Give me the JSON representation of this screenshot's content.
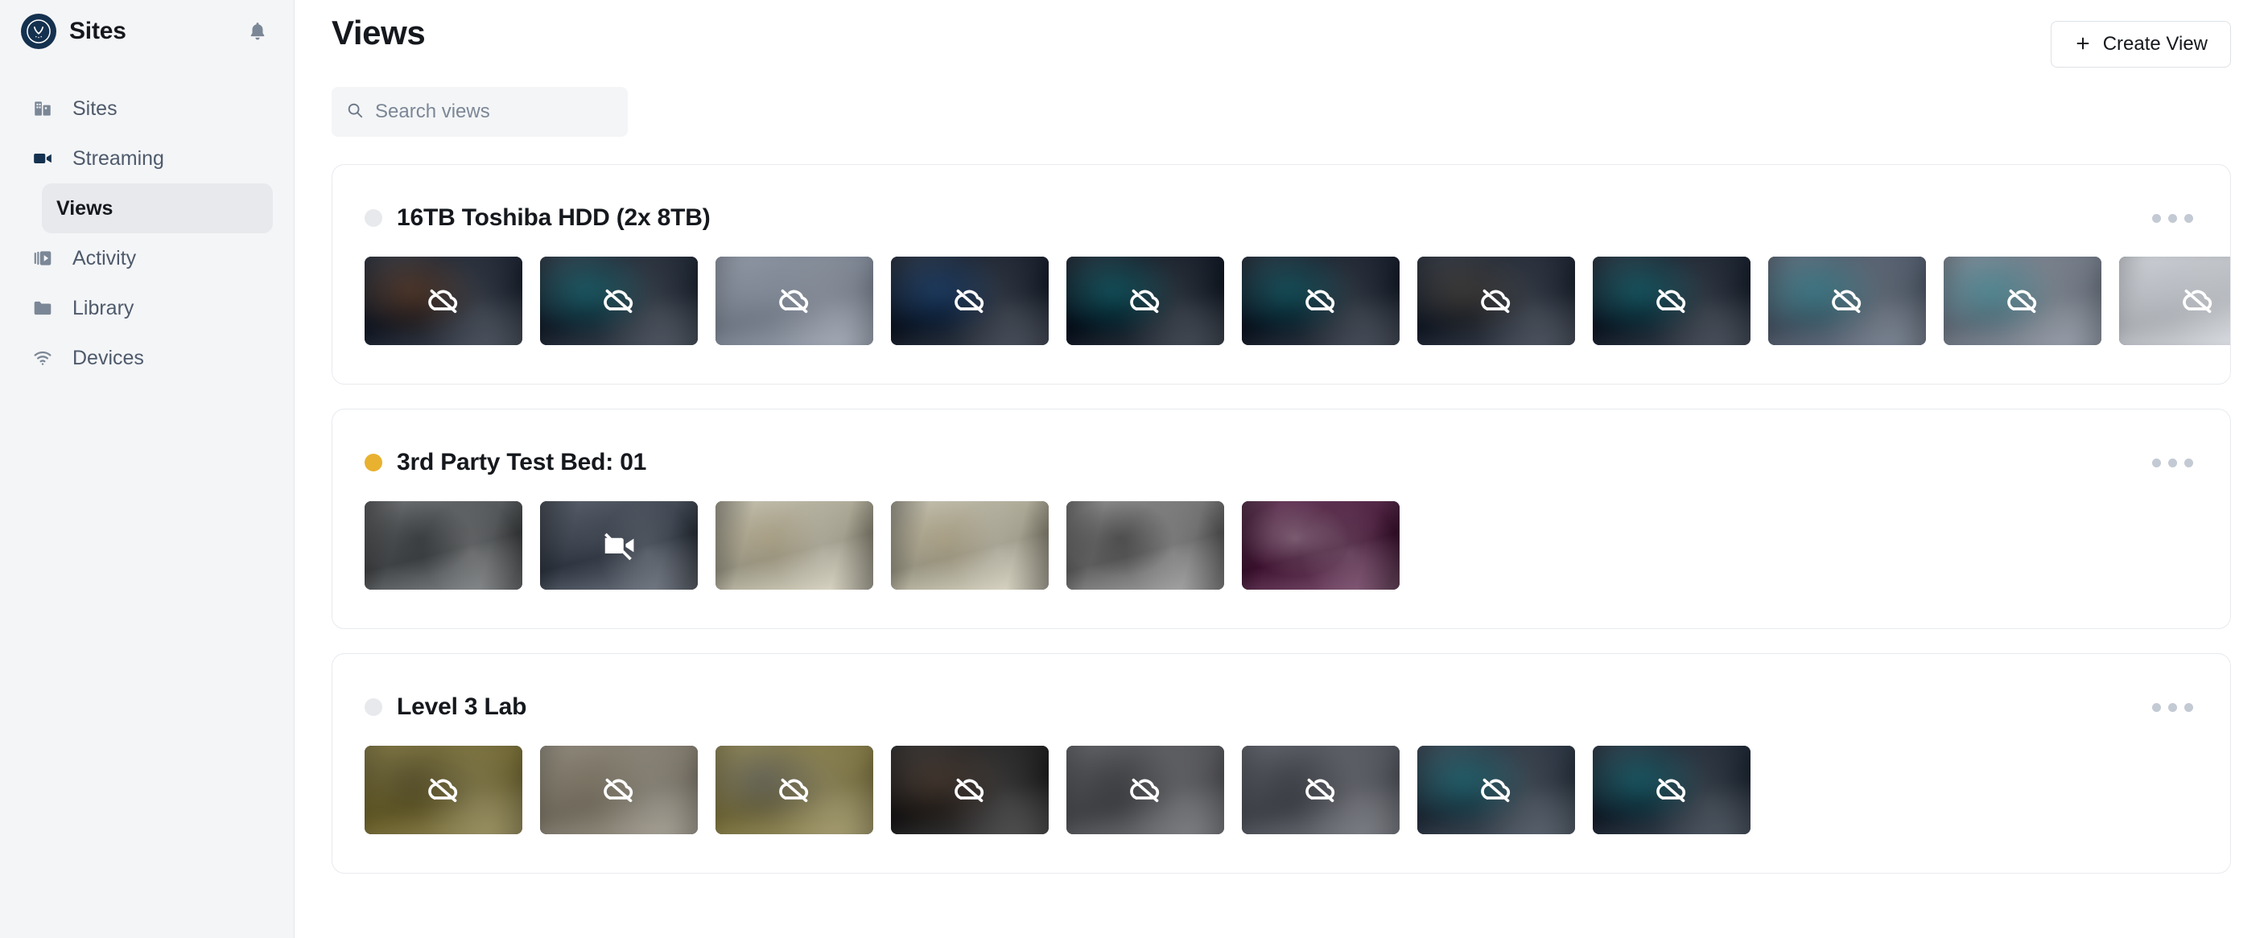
{
  "sidebar": {
    "brand": {
      "title": "Sites",
      "logo_icon": "owl-logo",
      "bell_icon": "bell-icon"
    },
    "items": [
      {
        "label": "Sites",
        "icon": "buildings-icon",
        "active": false
      },
      {
        "label": "Streaming",
        "icon": "video-camera-icon",
        "active": true
      },
      {
        "label": "Activity",
        "icon": "video-library-icon",
        "active": false
      },
      {
        "label": "Library",
        "icon": "folder-icon",
        "active": false
      },
      {
        "label": "Devices",
        "icon": "wifi-icon",
        "active": false
      }
    ],
    "sub_item": {
      "label": "Views",
      "selected": true
    }
  },
  "header": {
    "title": "Views",
    "create_button": {
      "label": "Create View",
      "icon": "plus-icon"
    }
  },
  "search": {
    "placeholder": "Search views",
    "value": "",
    "icon": "search-icon"
  },
  "colors": {
    "status_offline": "#e7e9ed",
    "status_warning": "#e8b130",
    "accent_dark": "#14314f",
    "sidebar_bg": "#f4f5f7",
    "card_border": "#e7eaee",
    "text_primary": "#15181d",
    "text_muted": "#4e5a6b",
    "menu_dot": "#c3cad4"
  },
  "views": [
    {
      "title": "16TB Toshiba HDD (2x 8TB)",
      "status": "offline",
      "status_color": "#e7e9ed",
      "menu_icon": "more-horizontal-icon",
      "overflow": true,
      "thumbnails": [
        {
          "overlay_icon": "cloud-off-icon",
          "blurred": true,
          "tint": "#39404c",
          "accent": "#b8601f"
        },
        {
          "overlay_icon": "cloud-off-icon",
          "blurred": true,
          "tint": "#3b434f",
          "accent": "#19c3c9"
        },
        {
          "overlay_icon": "cloud-off-icon",
          "blurred": true,
          "tint": "#98a0ad",
          "accent": "#98a0ad"
        },
        {
          "overlay_icon": "cloud-off-icon",
          "blurred": true,
          "tint": "#343b47",
          "accent": "#2c7ad1"
        },
        {
          "overlay_icon": "cloud-off-icon",
          "blurred": true,
          "tint": "#2f3641",
          "accent": "#19c3c9"
        },
        {
          "overlay_icon": "cloud-off-icon",
          "blurred": true,
          "tint": "#333a46",
          "accent": "#19b7bd"
        },
        {
          "overlay_icon": "cloud-off-icon",
          "blurred": true,
          "tint": "#3a414d",
          "accent": "#7f6a4a"
        },
        {
          "overlay_icon": "cloud-off-icon",
          "blurred": true,
          "tint": "#353d49",
          "accent": "#19c3c9"
        },
        {
          "overlay_icon": "cloud-off-icon",
          "blurred": true,
          "tint": "#6b7584",
          "accent": "#1fb9c0"
        },
        {
          "overlay_icon": "cloud-off-icon",
          "blurred": true,
          "tint": "#8a929e",
          "accent": "#1fb0b8"
        },
        {
          "overlay_icon": "cloud-off-icon",
          "blurred": true,
          "tint": "#d6d9de",
          "accent": "#c2c8d0"
        },
        {
          "overlay_icon": "cloud-off-icon",
          "blurred": true,
          "tint": "#e9ebee",
          "accent": "#dfe2e6"
        }
      ]
    },
    {
      "title": "3rd Party Test Bed: 01",
      "status": "warning",
      "status_color": "#e8b130",
      "menu_icon": "more-horizontal-icon",
      "overflow": false,
      "thumbnails": [
        {
          "overlay_icon": null,
          "blurred": false,
          "tint": "#6f7274",
          "accent": "#1a1c1e"
        },
        {
          "overlay_icon": "video-off-icon",
          "blurred": false,
          "tint": "#5b626d",
          "accent": "#4c535e"
        },
        {
          "overlay_icon": null,
          "blurred": false,
          "tint": "#c6c2b0",
          "accent": "#ad9a72"
        },
        {
          "overlay_icon": null,
          "blurred": false,
          "tint": "#c6c2b0",
          "accent": "#ad9a72"
        },
        {
          "overlay_icon": null,
          "blurred": false,
          "tint": "#8e8e8e",
          "accent": "#121212"
        },
        {
          "overlay_icon": null,
          "blurred": false,
          "tint": "#6b3f5e",
          "accent": "#d8d6d4"
        }
      ]
    },
    {
      "title": "Level 3 Lab",
      "status": "offline",
      "status_color": "#e7e9ed",
      "menu_icon": "more-horizontal-icon",
      "overflow": false,
      "thumbnails": [
        {
          "overlay_icon": "cloud-off-icon",
          "blurred": true,
          "tint": "#8e8451",
          "accent": "#2c2b27"
        },
        {
          "overlay_icon": "cloud-off-icon",
          "blurred": true,
          "tint": "#9a9487",
          "accent": "#7d7461"
        },
        {
          "overlay_icon": "cloud-off-icon",
          "blurred": true,
          "tint": "#9a9160",
          "accent": "#3c4a86"
        },
        {
          "overlay_icon": "cloud-off-icon",
          "blurred": true,
          "tint": "#3d3c3c",
          "accent": "#8d6a52"
        },
        {
          "overlay_icon": "cloud-off-icon",
          "blurred": true,
          "tint": "#6e6f73",
          "accent": "#26282c"
        },
        {
          "overlay_icon": "cloud-off-icon",
          "blurred": true,
          "tint": "#6c6f76",
          "accent": "#2a2c31"
        },
        {
          "overlay_icon": "cloud-off-icon",
          "blurred": true,
          "tint": "#46505c",
          "accent": "#18b9c2"
        },
        {
          "overlay_icon": "cloud-off-icon",
          "blurred": true,
          "tint": "#3a434f",
          "accent": "#17bcc4"
        }
      ]
    }
  ]
}
